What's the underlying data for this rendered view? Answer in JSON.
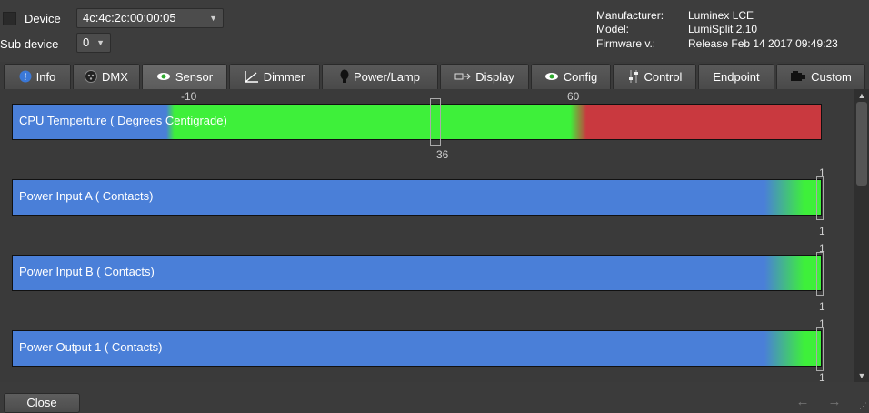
{
  "header": {
    "device_label": "Device",
    "device_value": "4c:4c:2c:00:00:05",
    "subdevice_label": "Sub device",
    "subdevice_value": "0",
    "manufacturer_label": "Manufacturer:",
    "manufacturer_value": "Luminex LCE",
    "model_label": "Model:",
    "model_value": "LumiSplit 2.10",
    "firmware_label": "Firmware v.:",
    "firmware_value": "Release Feb 14 2017 09:49:23"
  },
  "tabs": [
    {
      "label": "Info",
      "icon": "info-icon"
    },
    {
      "label": "DMX",
      "icon": "dmx-icon"
    },
    {
      "label": "Sensor",
      "icon": "eye-icon"
    },
    {
      "label": "Dimmer",
      "icon": "dimmer-curve-icon"
    },
    {
      "label": "Power/Lamp",
      "icon": "bulb-icon"
    },
    {
      "label": "Display",
      "icon": "display-icon"
    },
    {
      "label": "Config",
      "icon": "eye-icon"
    },
    {
      "label": "Control",
      "icon": "control-icon"
    },
    {
      "label": "Endpoint",
      "icon": ""
    },
    {
      "label": "Custom",
      "icon": "custom-icon"
    }
  ],
  "active_tab": "Sensor",
  "sensors": [
    {
      "label": "CPU Temperture ( Degrees Centigrade)",
      "min_tick": "-10",
      "max_tick": "60",
      "current": "36",
      "current_value": 36
    },
    {
      "label": "Power Input A ( Contacts)",
      "top_tick": "1",
      "bottom_tick": "1",
      "current_value": 1
    },
    {
      "label": "Power Input B ( Contacts)",
      "top_tick": "1",
      "bottom_tick": "1",
      "current_value": 1
    },
    {
      "label": "Power Output 1 ( Contacts)",
      "top_tick": "1",
      "bottom_tick": "1",
      "current_value": 1
    }
  ],
  "footer": {
    "close_label": "Close"
  },
  "colors": {
    "blue": "#4a7fd8",
    "green": "#3ef03a",
    "red": "#c9393f"
  }
}
